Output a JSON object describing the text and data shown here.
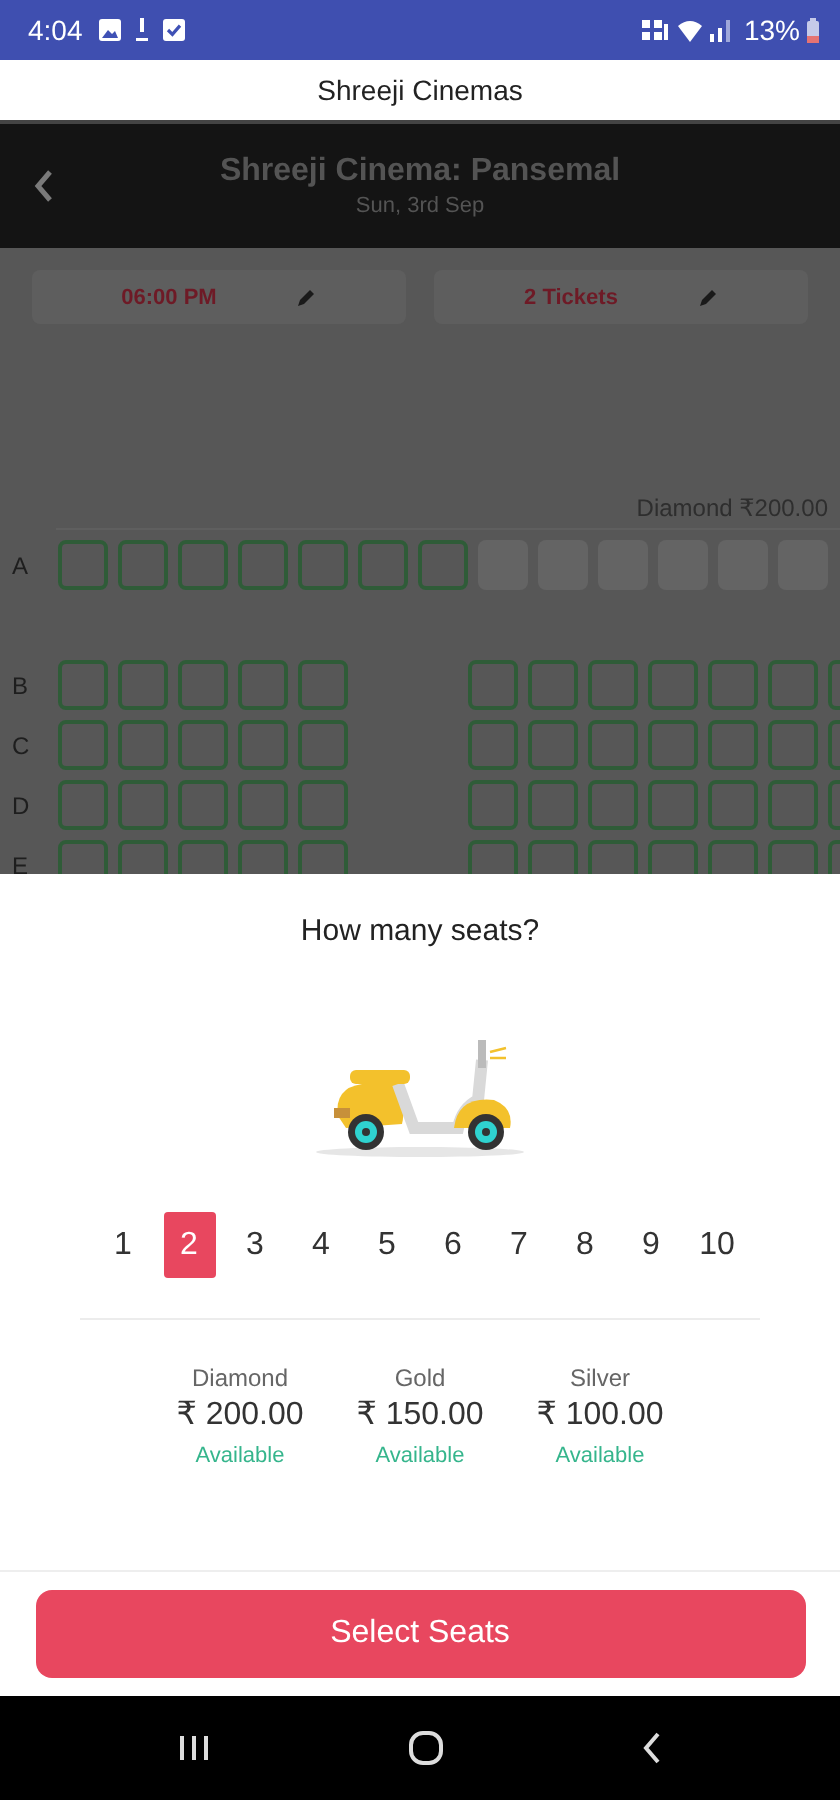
{
  "status_bar": {
    "time": "4:04",
    "battery": "13%"
  },
  "app_bar": {
    "title": "Shreeji Cinemas"
  },
  "header": {
    "title": "Shreeji Cinema: Pansemal",
    "subtitle": "Sun, 3rd Sep"
  },
  "filters": [
    {
      "value": "06:00 PM"
    },
    {
      "value": "2 Tickets"
    }
  ],
  "seat_map": {
    "section_label": "Diamond ₹200.00",
    "rows": [
      {
        "label": "A",
        "blocks": [
          [
            {
              "available": true
            },
            {
              "available": true
            },
            {
              "available": true
            },
            {
              "available": true
            },
            {
              "available": true
            },
            {
              "available": true
            },
            {
              "available": true
            },
            {
              "available": false
            },
            {
              "available": false
            },
            {
              "available": false
            },
            {
              "available": false
            },
            {
              "available": false
            },
            {
              "available": false
            }
          ]
        ]
      },
      {
        "label": "B",
        "blocks": [
          [
            {
              "available": true
            },
            {
              "available": true
            },
            {
              "available": true
            },
            {
              "available": true
            },
            {
              "available": true
            }
          ],
          [
            {
              "available": true
            },
            {
              "available": true
            },
            {
              "available": true
            },
            {
              "available": true
            },
            {
              "available": true
            },
            {
              "available": true
            },
            {
              "available": true
            }
          ]
        ]
      },
      {
        "label": "C",
        "blocks": [
          [
            {
              "available": true
            },
            {
              "available": true
            },
            {
              "available": true
            },
            {
              "available": true
            },
            {
              "available": true
            }
          ],
          [
            {
              "available": true
            },
            {
              "available": true
            },
            {
              "available": true
            },
            {
              "available": true
            },
            {
              "available": true
            },
            {
              "available": true
            },
            {
              "available": true
            }
          ]
        ]
      },
      {
        "label": "D",
        "blocks": [
          [
            {
              "available": true
            },
            {
              "available": true
            },
            {
              "available": true
            },
            {
              "available": true
            },
            {
              "available": true
            }
          ],
          [
            {
              "available": true
            },
            {
              "available": true
            },
            {
              "available": true
            },
            {
              "available": true
            },
            {
              "available": true
            },
            {
              "available": true
            },
            {
              "available": true
            }
          ]
        ]
      },
      {
        "label": "E",
        "blocks": [
          [
            {
              "available": true
            },
            {
              "available": true
            },
            {
              "available": true
            },
            {
              "available": true
            },
            {
              "available": true
            }
          ],
          [
            {
              "available": true
            },
            {
              "available": true
            },
            {
              "available": true
            },
            {
              "available": true
            },
            {
              "available": true
            },
            {
              "available": true
            },
            {
              "available": true
            }
          ]
        ]
      }
    ]
  },
  "sheet": {
    "question": "How many seats?",
    "counts": [
      {
        "label": "1",
        "selected": false
      },
      {
        "label": "2",
        "selected": true
      },
      {
        "label": "3",
        "selected": false
      },
      {
        "label": "4",
        "selected": false
      },
      {
        "label": "5",
        "selected": false
      },
      {
        "label": "6",
        "selected": false
      },
      {
        "label": "7",
        "selected": false
      },
      {
        "label": "8",
        "selected": false
      },
      {
        "label": "9",
        "selected": false
      },
      {
        "label": "10",
        "selected": false
      }
    ],
    "prices": [
      {
        "name": "Diamond",
        "price": "₹ 200.00",
        "availability": "Available"
      },
      {
        "name": "Gold",
        "price": "₹ 150.00",
        "availability": "Available"
      },
      {
        "name": "Silver",
        "price": "₹ 100.00",
        "availability": "Available"
      }
    ],
    "button": "Select Seats"
  }
}
